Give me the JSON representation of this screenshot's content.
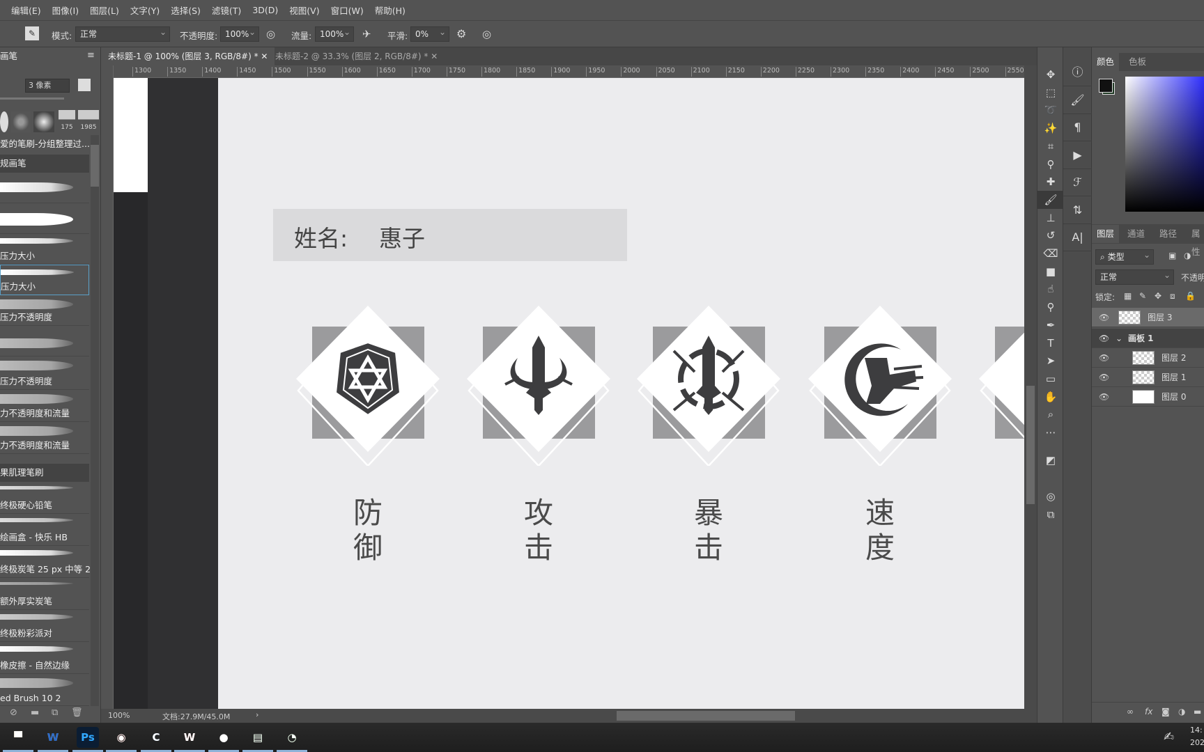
{
  "menu": [
    "编辑(E)",
    "图像(I)",
    "图层(L)",
    "文字(Y)",
    "选择(S)",
    "滤镜(T)",
    "3D(D)",
    "视图(V)",
    "窗口(W)",
    "帮助(H)"
  ],
  "options": {
    "mode_label": "模式:",
    "mode_value": "正常",
    "opacity_label": "不透明度:",
    "opacity_value": "100%",
    "flow_label": "流量:",
    "flow_value": "100%",
    "smooth_label": "平滑:",
    "smooth_value": "0%"
  },
  "tabs": [
    {
      "label": "未标题-1 @ 100% (图层 3, RGB/8#) *",
      "active": true
    },
    {
      "label": "未标题-2 @ 33.3% (图层 2, RGB/8#) *",
      "active": false
    }
  ],
  "ruler": [
    "1300",
    "1350",
    "1400",
    "1450",
    "1500",
    "1550",
    "1600",
    "1650",
    "1700",
    "1750",
    "1800",
    "1850",
    "1900",
    "1950",
    "2000",
    "2050",
    "2100",
    "2150",
    "2200",
    "2250",
    "2300",
    "2350",
    "2400",
    "2450",
    "2500",
    "2550"
  ],
  "brush_panel": {
    "title": "画笔",
    "size": "3 像素",
    "presets": [
      "175",
      "1985"
    ],
    "header": "爱的笔刷-分组整理过...",
    "group1": "规画笔",
    "items": [
      "压力大小",
      "压力大小",
      "压力不透明度",
      "压力不透明度",
      "力不透明度和流量",
      "力不透明度和流量"
    ],
    "group2": "果肌理笔刷",
    "items2": [
      "终极硬心铅笔",
      "绘画盒 - 快乐 HB",
      "终极炭笔 25 px 中等 2",
      "额外厚实炭笔",
      "终极粉彩派对",
      "橡皮擦 - 自然边缘",
      "ed Brush 10 2"
    ]
  },
  "canvas": {
    "name_label": "姓名:",
    "name_value": "惠子",
    "stats": [
      {
        "label": "防御",
        "icon": "shield-star-icon"
      },
      {
        "label": "攻击",
        "icon": "sword-icon"
      },
      {
        "label": "暴击",
        "icon": "sword-thorns-icon"
      },
      {
        "label": "速度",
        "icon": "boot-speed-icon"
      }
    ]
  },
  "status": {
    "zoom": "100%",
    "doc": "文档:27.9M/45.0M"
  },
  "color_panel": {
    "tabs": [
      "颜色",
      "色板"
    ],
    "fg": "#111111",
    "bg": "#1f3a24"
  },
  "layers_panel": {
    "tabs": [
      "图层",
      "通道",
      "路径",
      "属性"
    ],
    "filter": "类型",
    "blend": "正常",
    "opacity_label": "不透明",
    "lock_label": "锁定:",
    "layers": [
      {
        "name": "图层 3",
        "selected": true
      },
      {
        "name": "画板 1",
        "group": true
      },
      {
        "name": "图层 2"
      },
      {
        "name": "图层 1"
      },
      {
        "name": "图层 0"
      }
    ]
  },
  "taskbar": {
    "apps": [
      "file-explorer",
      "wps-writer",
      "photoshop",
      "chrome",
      "browser",
      "wps",
      "app",
      "notepad",
      "wechat"
    ],
    "clock": "14:",
    "date": "202"
  }
}
